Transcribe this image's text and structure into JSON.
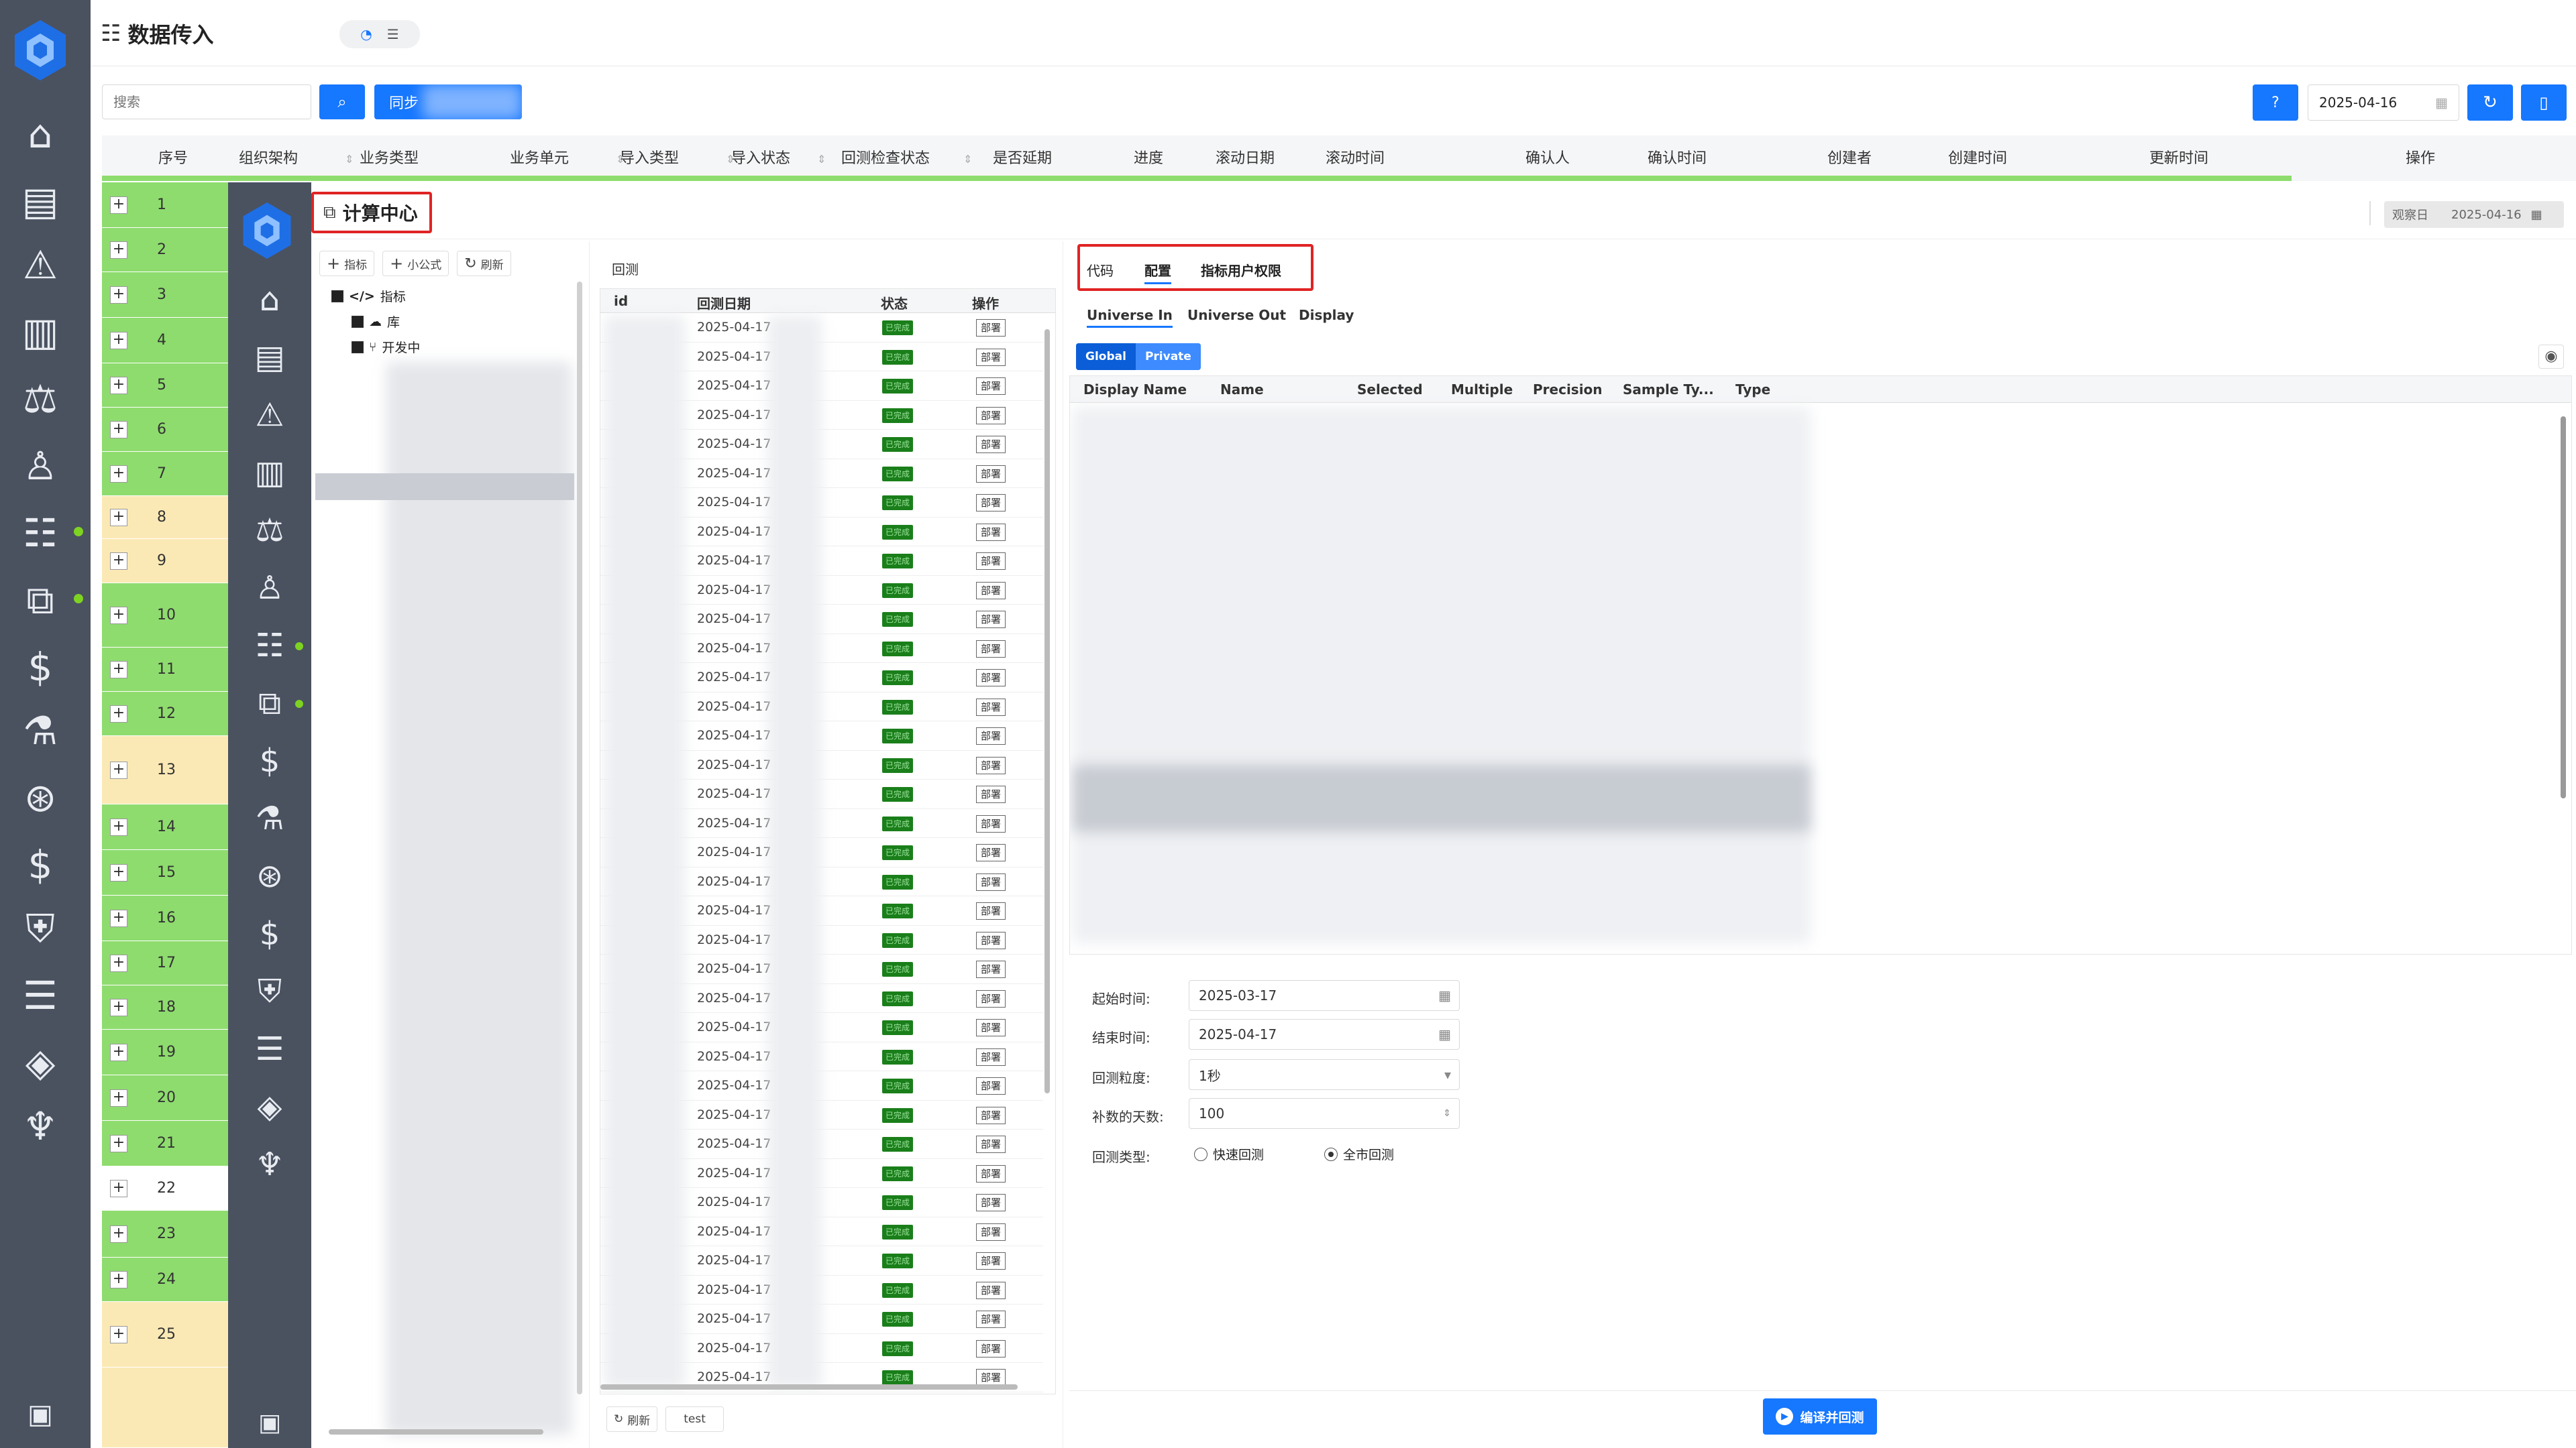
{
  "page_title": "数据传入",
  "search": {
    "placeholder": "搜索"
  },
  "sync_button": "同步",
  "help_label": "?",
  "top_date": "2025-04-16",
  "columns": [
    "序号",
    "组织架构",
    "业务类型",
    "业务单元",
    "导入类型",
    "导入状态",
    "回测检查状态",
    "是否延期",
    "进度",
    "滚动日期",
    "滚动时间",
    "确认人",
    "确认时间",
    "创建者",
    "创建时间",
    "更新时间",
    "操作"
  ],
  "rows": [
    {
      "n": "1",
      "color": "#8edc6e"
    },
    {
      "n": "2",
      "color": "#8edc6e"
    },
    {
      "n": "3",
      "color": "#8edc6e"
    },
    {
      "n": "4",
      "color": "#8edc6e"
    },
    {
      "n": "5",
      "color": "#8edc6e"
    },
    {
      "n": "6",
      "color": "#8edc6e"
    },
    {
      "n": "7",
      "color": "#8edc6e"
    },
    {
      "n": "8",
      "color": "#fbe9b5"
    },
    {
      "n": "9",
      "color": "#fbe9b5"
    },
    {
      "n": "10",
      "color": "#8edc6e"
    },
    {
      "n": "11",
      "color": "#8edc6e"
    },
    {
      "n": "12",
      "color": "#8edc6e"
    },
    {
      "n": "13",
      "color": "#fbe9b5"
    },
    {
      "n": "14",
      "color": "#8edc6e"
    },
    {
      "n": "15",
      "color": "#8edc6e"
    },
    {
      "n": "16",
      "color": "#8edc6e"
    },
    {
      "n": "17",
      "color": "#8edc6e"
    },
    {
      "n": "18",
      "color": "#8edc6e"
    },
    {
      "n": "19",
      "color": "#8edc6e"
    },
    {
      "n": "20",
      "color": "#8edc6e"
    },
    {
      "n": "21",
      "color": "#8edc6e"
    },
    {
      "n": "22",
      "color": "#ffffff"
    },
    {
      "n": "23",
      "color": "#8edc6e"
    },
    {
      "n": "24",
      "color": "#8edc6e"
    },
    {
      "n": "25",
      "color": "#fbe9b5"
    }
  ],
  "panel": {
    "title": "计算中心",
    "observe_label": "观察日",
    "observe_date": "2025-04-16",
    "toolbar": {
      "indicator": "指标",
      "formula": "小公式",
      "refresh": "刷新"
    },
    "tree": {
      "root": "指标",
      "lib": "库",
      "dev": "开发中"
    },
    "backtest": {
      "title": "回测",
      "headers": {
        "id": "id",
        "date": "回测日期",
        "status": "状态",
        "op": "操作"
      },
      "date_value": "2025-04-17",
      "status_value": "已完成",
      "op_value": "部署",
      "refresh": "刷新",
      "tag": "test"
    },
    "tabs": [
      "代码",
      "配置",
      "指标用户权限"
    ],
    "subtabs": [
      "Universe In",
      "Universe Out",
      "Display"
    ],
    "toggle": [
      "Global",
      "Private"
    ],
    "table_headers": [
      "Display Name",
      "Name",
      "Selected",
      "Multiple",
      "Precision",
      "Sample Ty...",
      "Type"
    ],
    "form": {
      "start_label": "起始时间:",
      "start_value": "2025-03-17",
      "end_label": "结束时间:",
      "end_value": "2025-04-17",
      "gran_label": "回测粒度:",
      "gran_value": "1秒",
      "days_label": "补数的天数:",
      "days_value": "100",
      "type_label": "回测类型:",
      "type_quick": "快速回测",
      "type_full": "全市回测"
    },
    "compile_button": "编译并回测"
  }
}
